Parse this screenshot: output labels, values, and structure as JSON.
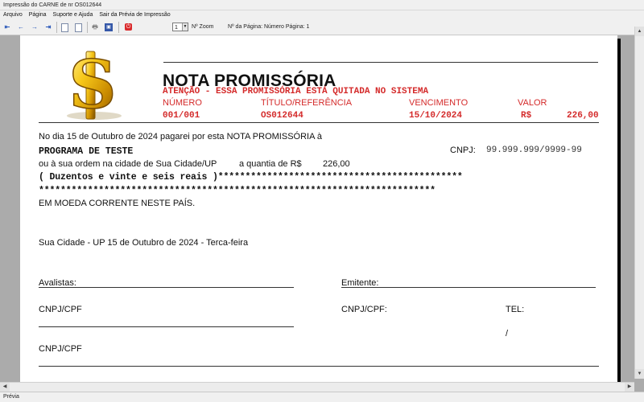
{
  "window": {
    "title": "Impressão do CARNE de nr OS012644"
  },
  "menu": [
    "Arquivo",
    "Página",
    "Suporte e Ajuda",
    "Sair da Prévia de Impressão"
  ],
  "toolbar": {
    "zoom_value": "1",
    "zoom_label": "Nº Zoom",
    "page_label": "Nº da Página: Número Página: 1"
  },
  "status": {
    "text": "Prévia"
  },
  "document": {
    "title": "NOTA PROMISSÓRIA",
    "warning": "ATENÇÃO - ESSA PROMISSÓRIA ESTÁ QUITADA NO SISTEMA",
    "headers": {
      "numero": "NÚMERO",
      "titulo": "TÍTULO/REFERÊNCIA",
      "vencimento": "VENCIMENTO",
      "valor": "VALOR"
    },
    "values": {
      "numero": "001/001",
      "titulo": "OS012644",
      "vencimento": "15/10/2024",
      "moeda": "R$",
      "valor": "226,00"
    },
    "line1": "No dia 15 de Outubro de 2024 pagarei por esta NOTA PROMISSÓRIA à",
    "payee": "PROGRAMA DE TESTE",
    "cnpj_label": "CNPJ:",
    "cnpj_value": "99.999.999/9999-99",
    "line2_a": "ou à sua ordem na cidade de Sua Cidade/UP",
    "line2_b": "a quantia de R$",
    "line2_amount": "226,00",
    "amount_words": "( Duzentos e vinte e seis reais )*********************************************",
    "stars_line": "*************************************************************************",
    "currency_line": "EM MOEDA CORRENTE NESTE PAÍS.",
    "place_date": "Sua Cidade - UP 15 de Outubro de 2024 - Terca-feira",
    "avalistas_label": "Avalistas:",
    "emitente_label": "Emitente:",
    "cnpj_cpf_1": "CNPJ/CPF",
    "cnpj_cpf_emitente": "CNPJ/CPF:",
    "tel_label": "TEL:",
    "slash": "/",
    "cnpj_cpf_2": "CNPJ/CPF"
  }
}
